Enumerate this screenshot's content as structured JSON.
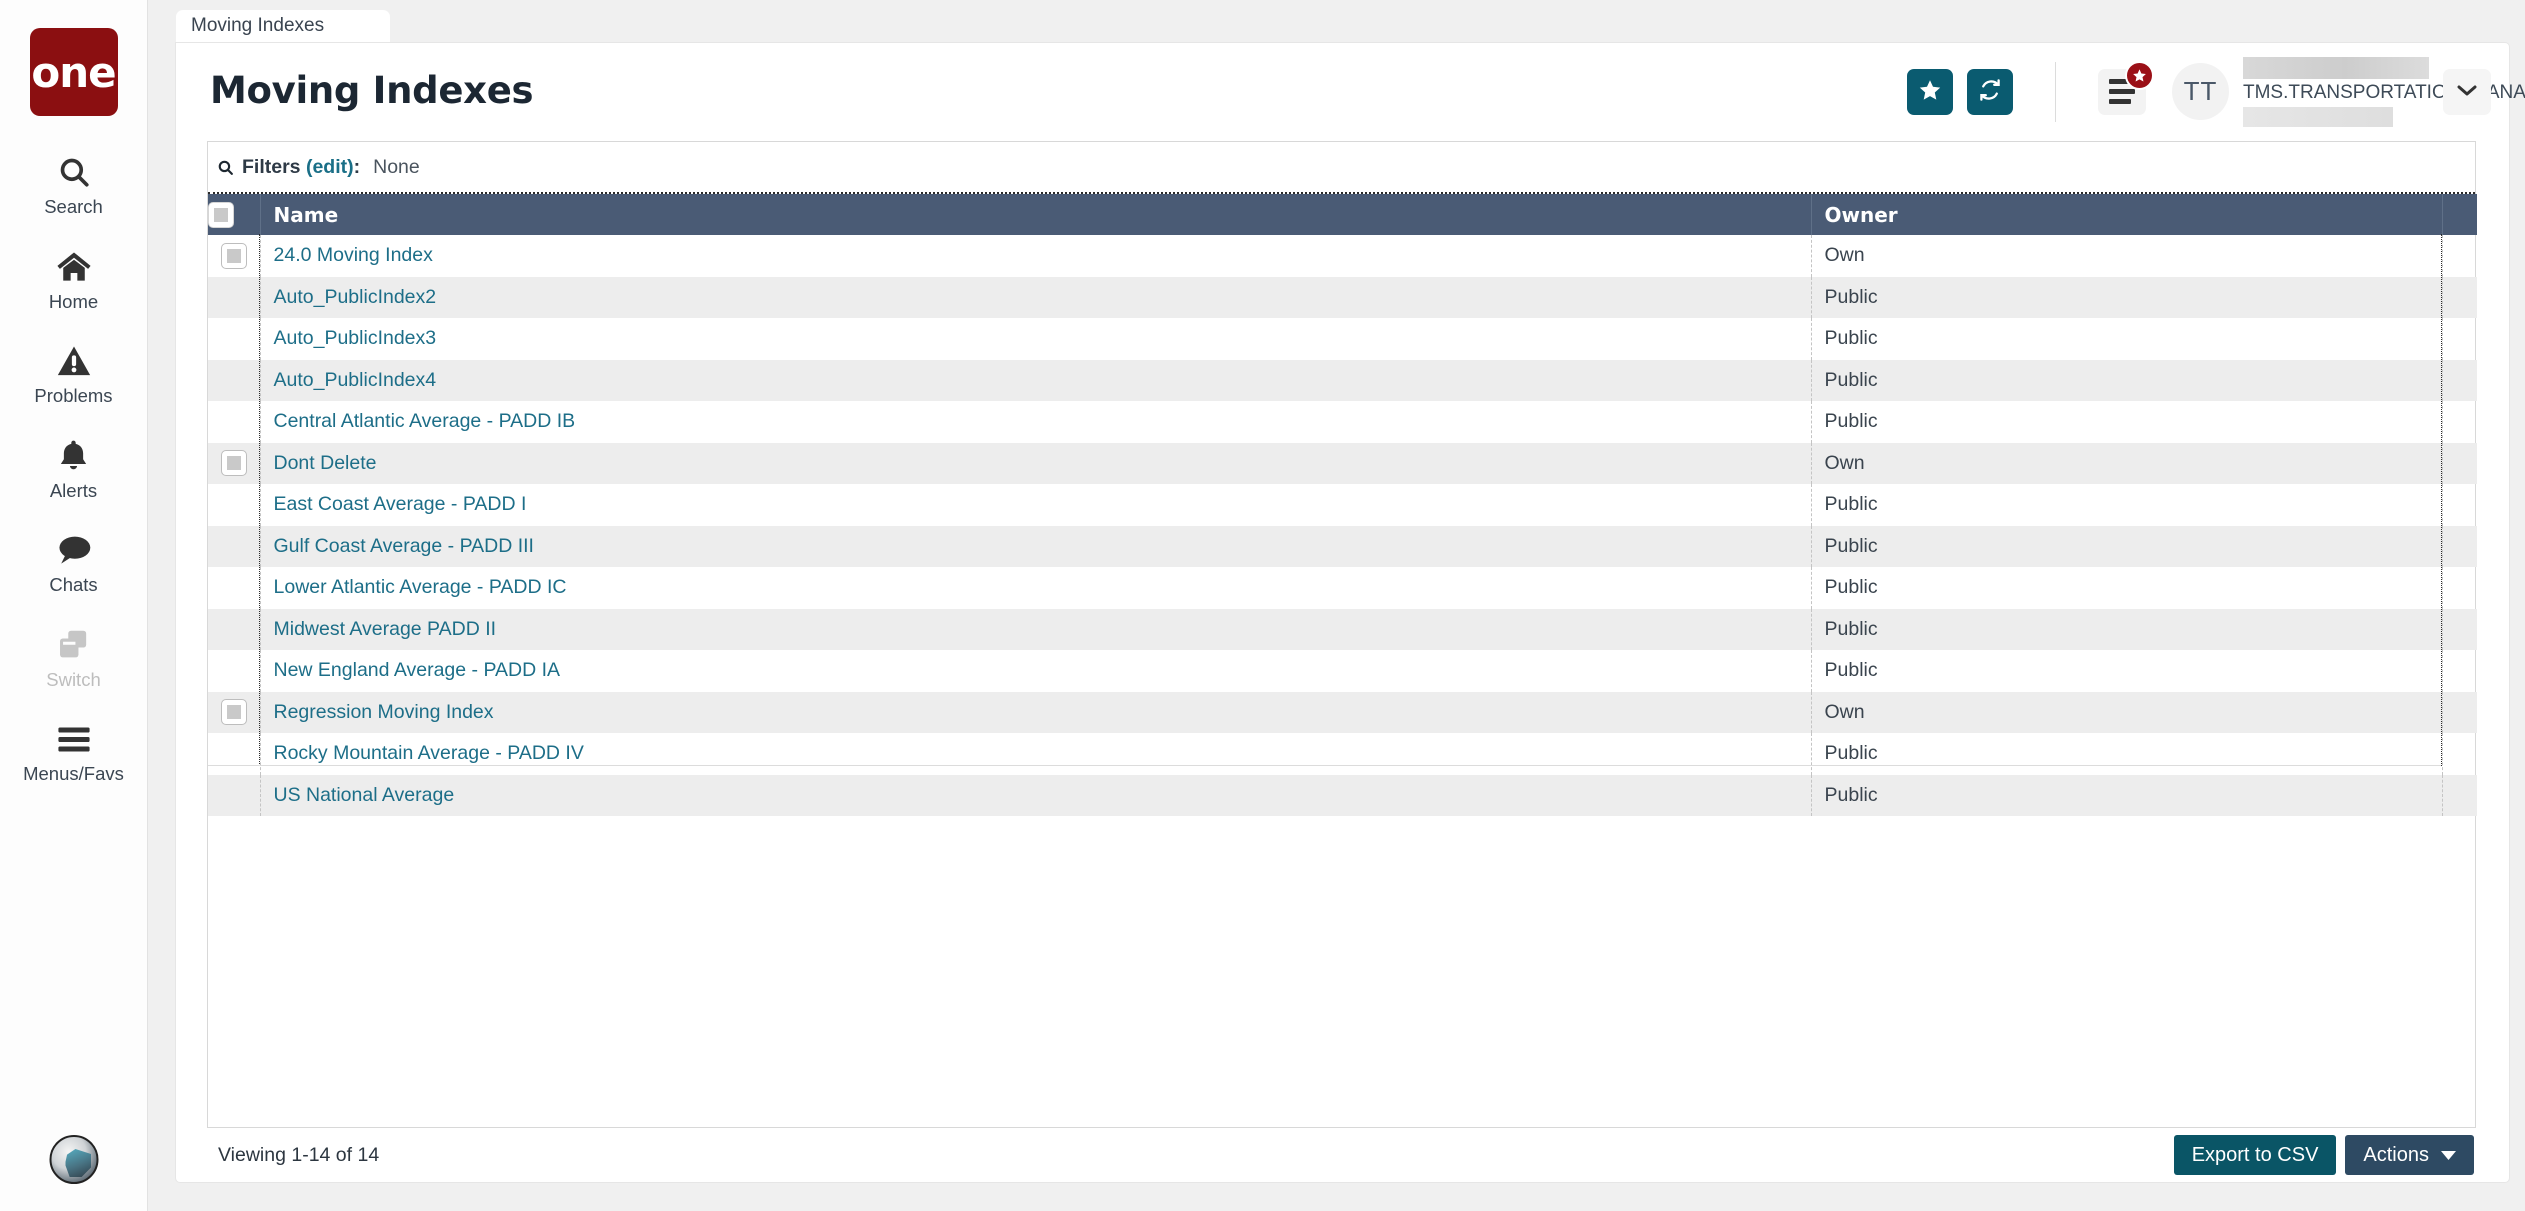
{
  "brand": {
    "logo_text": "one",
    "logo_color": "#8b0f11"
  },
  "rail": {
    "items": [
      {
        "label": "Search",
        "icon": "search-icon",
        "disabled": false
      },
      {
        "label": "Home",
        "icon": "home-icon",
        "disabled": false
      },
      {
        "label": "Problems",
        "icon": "warning-triangle-icon",
        "disabled": false
      },
      {
        "label": "Alerts",
        "icon": "bell-icon",
        "disabled": false
      },
      {
        "label": "Chats",
        "icon": "chat-bubble-icon",
        "disabled": false
      },
      {
        "label": "Switch",
        "icon": "switch-windows-icon",
        "disabled": true
      },
      {
        "label": "Menus/Favs",
        "icon": "hamburger-icon",
        "disabled": false
      }
    ],
    "avatar": "user-avatar"
  },
  "tab": {
    "label": "Moving Indexes"
  },
  "header": {
    "title": "Moving Indexes",
    "favorite_icon": "star-icon",
    "refresh_icon": "refresh-icon",
    "menu_icon": "menu-lines-icon",
    "menu_badge_icon": "star-badge-icon",
    "avatar_initials": "TT",
    "username": "TMS.TRANSPORTATION_MANAGER",
    "caret_icon": "chevron-down-icon",
    "accent_teal": "#0a5b70",
    "badge_red": "#9b1017"
  },
  "filters": {
    "icon": "search-icon",
    "label": "Filters",
    "edit_label": "(edit)",
    "colon": ":",
    "value": "None"
  },
  "table": {
    "header_color": "#4a5b75",
    "columns": [
      "",
      "Name",
      "Owner",
      ""
    ],
    "rows": [
      {
        "checkbox": true,
        "name": "24.0 Moving Index",
        "owner": "Own"
      },
      {
        "checkbox": false,
        "name": "Auto_PublicIndex2",
        "owner": "Public"
      },
      {
        "checkbox": false,
        "name": "Auto_PublicIndex3",
        "owner": "Public"
      },
      {
        "checkbox": false,
        "name": "Auto_PublicIndex4",
        "owner": "Public"
      },
      {
        "checkbox": false,
        "name": "Central Atlantic Average - PADD IB",
        "owner": "Public"
      },
      {
        "checkbox": true,
        "name": "Dont Delete",
        "owner": "Own"
      },
      {
        "checkbox": false,
        "name": "East Coast Average - PADD I",
        "owner": "Public"
      },
      {
        "checkbox": false,
        "name": "Gulf Coast Average - PADD III",
        "owner": "Public"
      },
      {
        "checkbox": false,
        "name": "Lower Atlantic Average - PADD IC",
        "owner": "Public"
      },
      {
        "checkbox": false,
        "name": "Midwest Average PADD II",
        "owner": "Public"
      },
      {
        "checkbox": false,
        "name": "New England Average - PADD IA",
        "owner": "Public"
      },
      {
        "checkbox": true,
        "name": "Regression Moving Index",
        "owner": "Own"
      },
      {
        "checkbox": false,
        "name": "Rocky Mountain Average - PADD IV",
        "owner": "Public"
      },
      {
        "checkbox": false,
        "name": "US National Average",
        "owner": "Public"
      }
    ]
  },
  "footer": {
    "viewing": "Viewing 1-14 of 14",
    "export_label": "Export to CSV",
    "actions_label": "Actions",
    "actions_caret_icon": "caret-down-icon",
    "export_color": "#0a5566",
    "actions_color": "#2e4a63"
  }
}
